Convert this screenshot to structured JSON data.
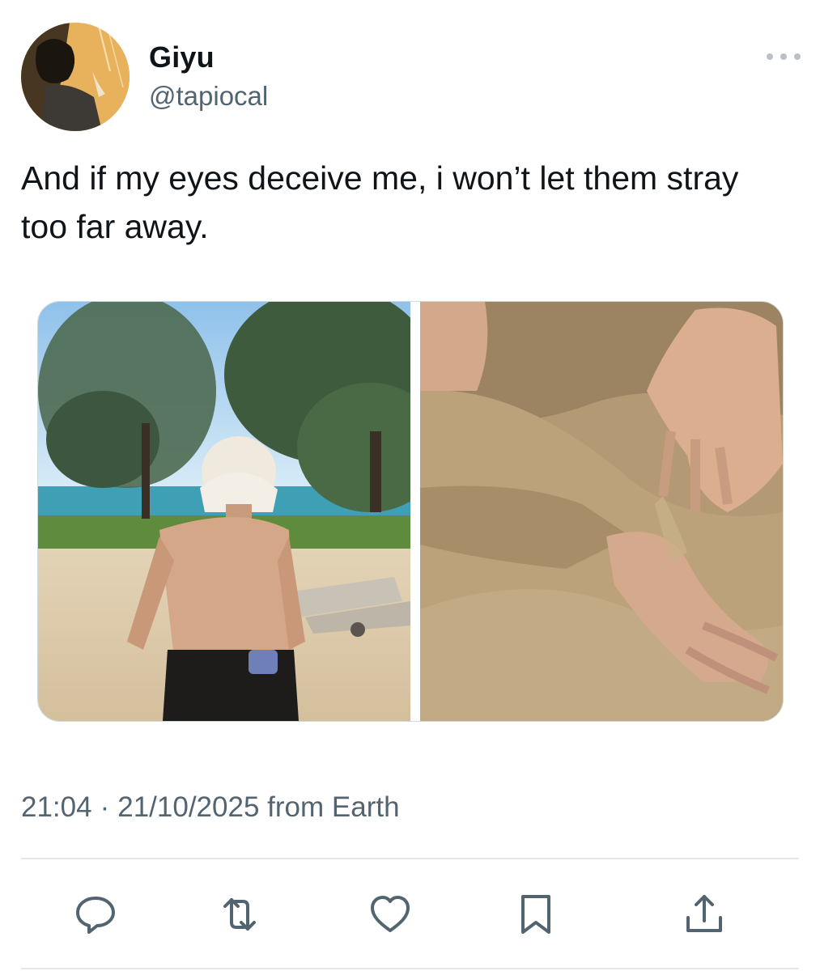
{
  "author": {
    "display_name": "Giyu",
    "handle": "@tapiocal",
    "avatar_icon": "profile-photo"
  },
  "header": {
    "more_icon": "ellipsis-icon"
  },
  "tweet": {
    "text": "And if my eyes deceive me, i won’t let them stray too far away.",
    "media": [
      {
        "name": "beach-photo",
        "description_icon": "photo"
      },
      {
        "name": "sand-hands-photo",
        "description_icon": "photo"
      }
    ]
  },
  "meta": {
    "time": "21:04",
    "separator": "·",
    "date": "21/10/2025",
    "source": "from Earth"
  },
  "actions": [
    {
      "name": "reply",
      "icon": "speech-bubble-icon"
    },
    {
      "name": "retweet",
      "icon": "retweet-icon"
    },
    {
      "name": "like",
      "icon": "heart-icon"
    },
    {
      "name": "bookmark",
      "icon": "bookmark-icon"
    },
    {
      "name": "share",
      "icon": "share-icon"
    }
  ],
  "colors": {
    "text": "#0f1419",
    "secondary": "#536471",
    "divider": "#e3e8eb",
    "icon": "#536471"
  }
}
